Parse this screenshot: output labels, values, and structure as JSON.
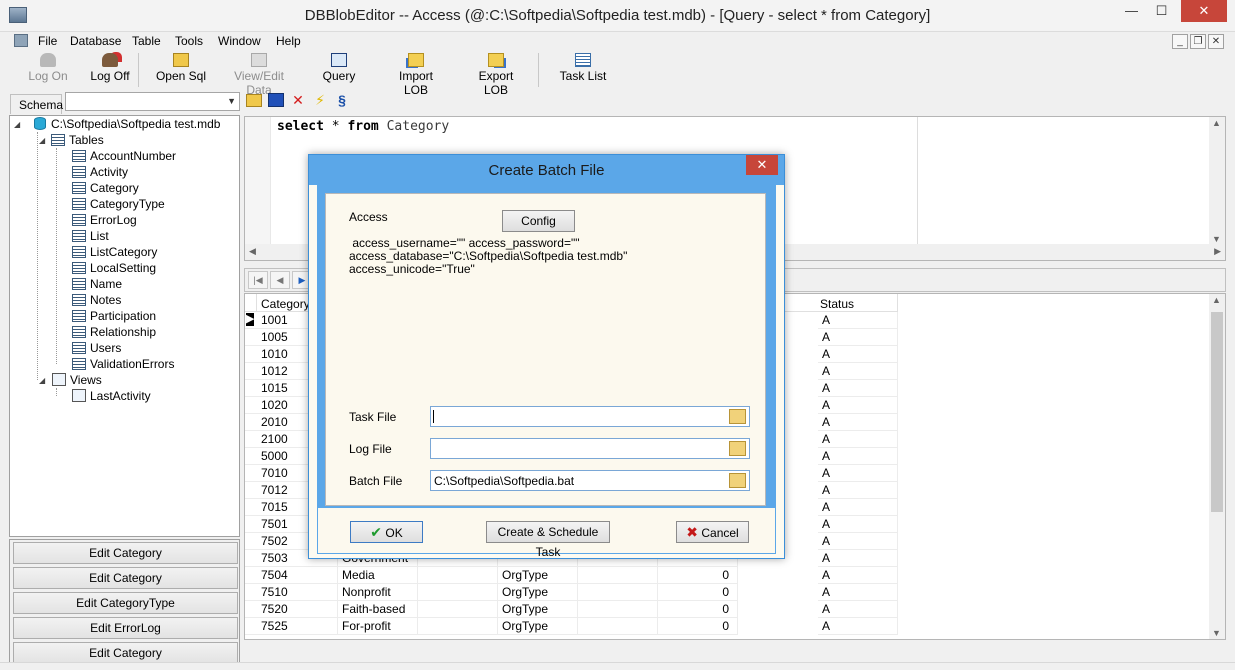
{
  "window": {
    "title": "DBBlobEditor -- Access (@:C:\\Softpedia\\Softpedia test.mdb) - [Query - select * from Category]",
    "min": "—",
    "max": "☐",
    "close": "✕"
  },
  "menu": [
    "File",
    "Database",
    "Table",
    "Tools",
    "Window",
    "Help"
  ],
  "mdi": {
    "min": "_",
    "restore": "❐",
    "close": "✕"
  },
  "toolbar": {
    "log_on": "Log On",
    "log_off": "Log Off",
    "open_sql": "Open Sql",
    "view_edit_data": "View/Edit Data",
    "query": "Query",
    "import_lob": "Import LOB",
    "export_lob": "Export LOB",
    "task_list": "Task List"
  },
  "schema": {
    "label": "Schema",
    "value": ""
  },
  "tree": {
    "root": "C:\\Softpedia\\Softpedia test.mdb",
    "tables_label": "Tables",
    "tables": [
      "AccountNumber",
      "Activity",
      "Category",
      "CategoryType",
      "ErrorLog",
      "List",
      "ListCategory",
      "LocalSetting",
      "Name",
      "Notes",
      "Participation",
      "Relationship",
      "Users",
      "ValidationErrors"
    ],
    "views_label": "Views",
    "views": [
      "LastActivity"
    ]
  },
  "left_buttons": [
    "Edit Category",
    "Edit Category",
    "Edit CategoryType",
    "Edit ErrorLog",
    "Edit Category"
  ],
  "editor": {
    "kw_select": "select",
    "star": "*",
    "kw_from": "from",
    "table": "Category"
  },
  "grid": {
    "columns": [
      "Category",
      "",
      "",
      "",
      "",
      "",
      "Status"
    ],
    "rows": [
      [
        "1001",
        "",
        "",
        "",
        "",
        "",
        "A"
      ],
      [
        "1005",
        "",
        "",
        "",
        "",
        "",
        "A"
      ],
      [
        "1010",
        "",
        "",
        "",
        "",
        "",
        "A"
      ],
      [
        "1012",
        "",
        "",
        "",
        "",
        "",
        "A"
      ],
      [
        "1015",
        "",
        "",
        "",
        "",
        "",
        "A"
      ],
      [
        "1020",
        "",
        "",
        "",
        "",
        "",
        "A"
      ],
      [
        "2010",
        "",
        "",
        "",
        "",
        "",
        "A"
      ],
      [
        "2100",
        "",
        "",
        "",
        "",
        "",
        "A"
      ],
      [
        "5000",
        "",
        "",
        "",
        "",
        "",
        "A"
      ],
      [
        "7010",
        "",
        "",
        "",
        "",
        "",
        "A"
      ],
      [
        "7012",
        "",
        "",
        "",
        "",
        "",
        "A"
      ],
      [
        "7015",
        "",
        "",
        "",
        "",
        "",
        "A"
      ],
      [
        "7501",
        "",
        "",
        "",
        "",
        "",
        "A"
      ],
      [
        "7502",
        "",
        "",
        "",
        "",
        "",
        "A"
      ],
      [
        "7503",
        "Government",
        "",
        "",
        "",
        "",
        "A"
      ],
      [
        "7504",
        "Media",
        "",
        "OrgType",
        "",
        "0",
        "A"
      ],
      [
        "7510",
        "Nonprofit",
        "",
        "OrgType",
        "",
        "0",
        "A"
      ],
      [
        "7520",
        "Faith-based",
        "",
        "OrgType",
        "",
        "0",
        "A"
      ],
      [
        "7525",
        "For-profit",
        "",
        "OrgType",
        "",
        "0",
        "A"
      ]
    ]
  },
  "dialog": {
    "title": "Create Batch File",
    "close": "✕",
    "db_label": "Access",
    "config_button": "Config",
    "config_lines": [
      " access_username=\"\" access_password=\"\"",
      "access_database=\"C:\\Softpedia\\Softpedia test.mdb\"",
      "access_unicode=\"True\""
    ],
    "task_file_label": "Task File",
    "task_file_value": "",
    "log_file_label": "Log File",
    "log_file_value": "",
    "batch_file_label": "Batch File",
    "batch_file_value": "C:\\Softpedia\\Softpedia.bat",
    "ok_button": "OK",
    "schedule_button": "Create & Schedule Task",
    "cancel_button": "Cancel"
  },
  "colors": {
    "dialog_frame": "#5ba7e8",
    "close_red": "#c7463a",
    "dialog_bg": "#fdfbf1"
  }
}
